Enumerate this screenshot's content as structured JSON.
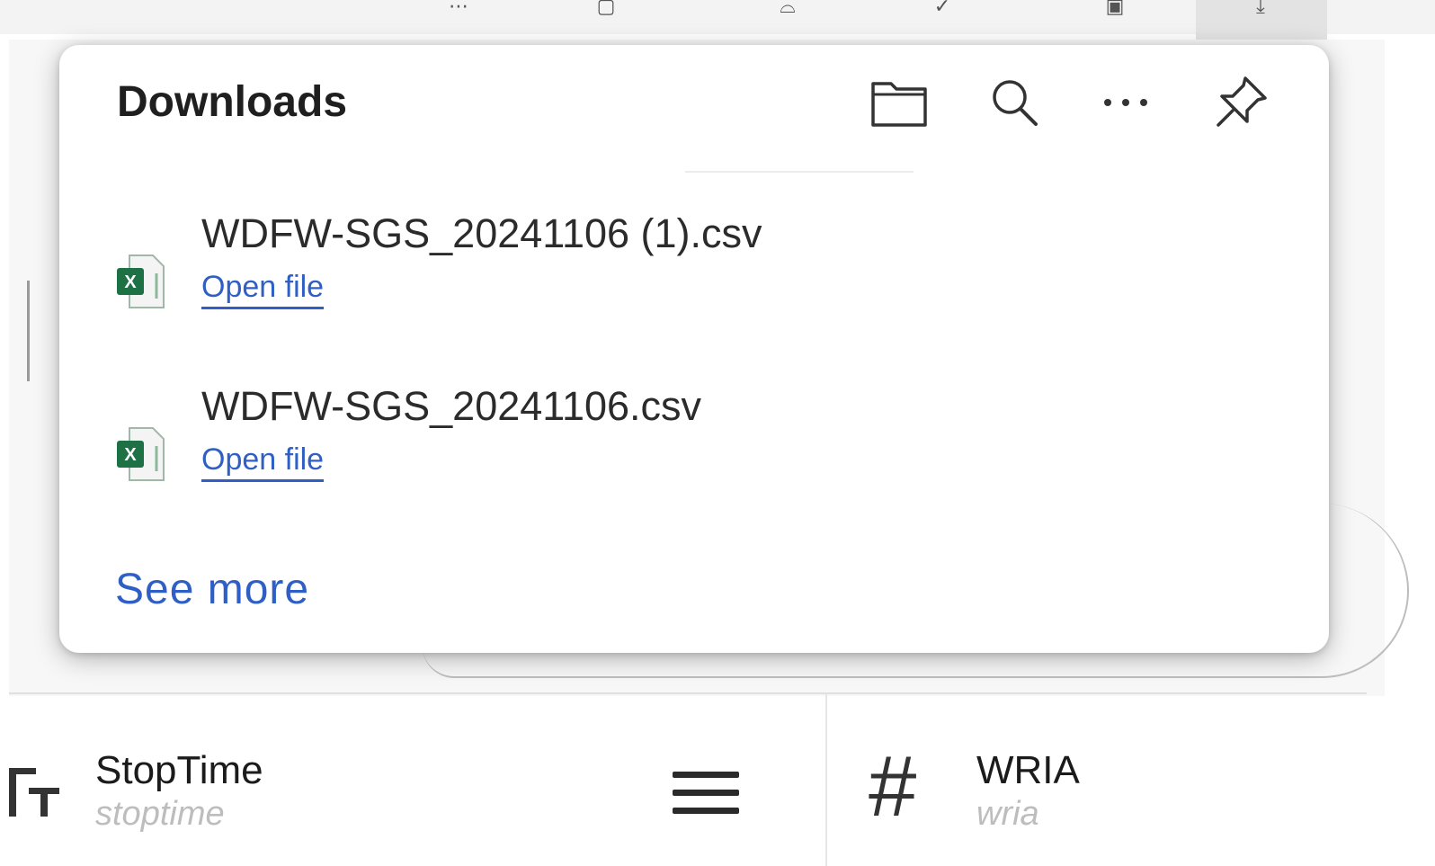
{
  "popup": {
    "title": "Downloads",
    "actions": {
      "open_folder": "open-folder-icon",
      "search": "search-icon",
      "more": "more-icon",
      "pin": "pin-icon"
    },
    "items": [
      {
        "filename": "WDFW-SGS_20241106 (1).csv",
        "link": "Open file",
        "icon": "excel-csv-file-icon"
      },
      {
        "filename": "WDFW-SGS_20241106.csv",
        "link": "Open file",
        "icon": "excel-csv-file-icon"
      }
    ],
    "see_more": "See more"
  },
  "columns": [
    {
      "icon": "text-type-icon",
      "title": "StopTime",
      "subtitle": "stoptime"
    },
    {
      "icon": "number-type-icon",
      "title": "WRIA",
      "subtitle": "wria"
    }
  ],
  "colors": {
    "link": "#2f5fc4",
    "excel_green": "#1e7145"
  }
}
